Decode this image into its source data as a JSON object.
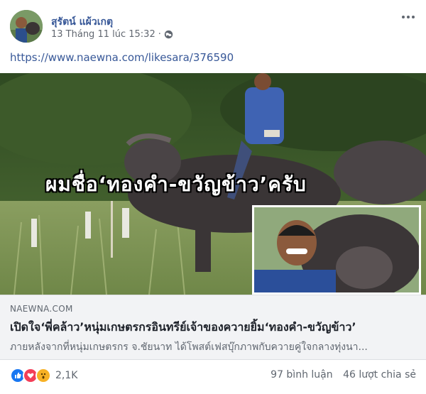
{
  "post": {
    "author": "สุรัตน์ แผ้วเกตุ",
    "timestamp": "13 Tháng 11 lúc 15:32",
    "privacy_icon": "globe-icon",
    "more_icon": "more-options-icon",
    "link": "https://www.naewna.com/likesara/376590"
  },
  "image": {
    "overlay_caption": "ผมชื่อ‘ทองคำ-ขวัญข้าว’ครับ"
  },
  "preview": {
    "domain": "NAEWNA.COM",
    "title": "เปิดใจ‘พี่คล้าว’หนุ่มเกษตรกรอินทรีย์เจ้าของควายยิ้ม‘ทองคำ-ขวัญข้าว’",
    "description": "ภายหลังจากที่หนุ่มเกษตรกร จ.ชัยนาท ได้โพสต์เฟสบุ๊กภาพกับควายคู่ใจกลางทุ่งนา..."
  },
  "footer": {
    "reaction_count": "2,1K",
    "comments": "97 bình luận",
    "shares": "46 lượt chia sẻ",
    "reaction_icons": [
      "like-icon",
      "love-icon",
      "wow-icon"
    ]
  },
  "colors": {
    "link_blue": "#385898",
    "like_blue": "#1877f2",
    "love_red": "#f33e58",
    "wow_yellow": "#f7b125"
  }
}
